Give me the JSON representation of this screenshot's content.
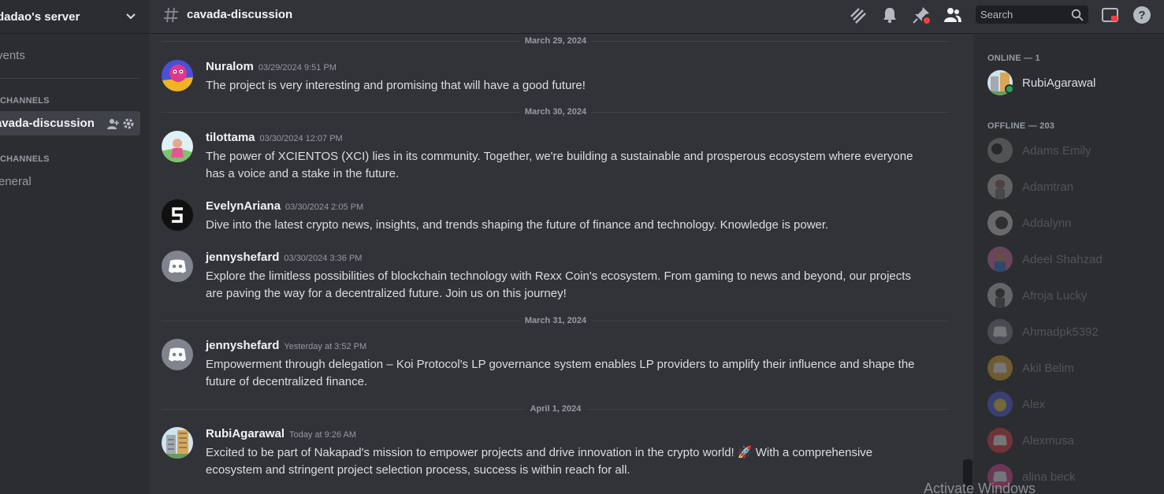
{
  "sidebar": {
    "server_name": "dadao's server",
    "events_label": "vents",
    "text_category": "CHANNELS",
    "active_channel": "avada-discussion",
    "voice_category": "CHANNELS",
    "general_label": "eneral"
  },
  "header": {
    "channel_name": "cavada-discussion",
    "search_placeholder": "Search"
  },
  "messages": [
    {
      "date": "March 29, 2024",
      "author": "Nuralom",
      "timestamp": "03/29/2024 9:51 PM",
      "text": "The project is very interesting and promising that will have a good future!"
    },
    {
      "date": "March 30, 2024",
      "author": "tilottama",
      "timestamp": "03/30/2024 12:07 PM",
      "text": "The power of XCIENTOS (XCI) lies in its community. Together, we're building a sustainable and prosperous ecosystem where everyone has a voice and a stake in the future."
    },
    {
      "author": "EvelynAriana",
      "timestamp": "03/30/2024 2:05 PM",
      "text": "Dive into the latest crypto news, insights, and trends shaping the future of finance and technology. Knowledge is power."
    },
    {
      "author": "jennyshefard",
      "timestamp": "03/30/2024 3:36 PM",
      "text": "Explore the limitless possibilities of blockchain technology with Rexx Coin's ecosystem. From gaming to news and beyond, our projects are paving the way for a decentralized future. Join us on this journey!"
    },
    {
      "date": "March 31, 2024",
      "author": "jennyshefard",
      "timestamp": "Yesterday at 3:52 PM",
      "text": "Empowerment through delegation – Koi Protocol's LP governance system enables LP providers to amplify their influence and shape the future of decentralized finance."
    },
    {
      "date": "April 1, 2024",
      "author": "RubiAgarawal",
      "timestamp": "Today at 9:26 AM",
      "text": "Excited to be part of Nakapad's mission to empower projects and drive innovation in the crypto world! 🚀 With a comprehensive ecosystem and stringent project selection process, success is within reach for all."
    }
  ],
  "members": {
    "online_header": "ONLINE — 1",
    "offline_header": "OFFLINE — 203",
    "online": [
      {
        "name": "RubiAgarawal"
      }
    ],
    "offline": [
      {
        "name": "Adams Emily"
      },
      {
        "name": "Adamtran"
      },
      {
        "name": "Addalynn"
      },
      {
        "name": "Adeel Shahzad"
      },
      {
        "name": "Afroja Lucky"
      },
      {
        "name": "Ahmadpk5392"
      },
      {
        "name": "Akil Belim"
      },
      {
        "name": "Alex"
      },
      {
        "name": "Alexmusa"
      },
      {
        "name": "alina beck"
      }
    ]
  },
  "watermark": "Activate Windows",
  "colors": {
    "background": "#313338",
    "sidebar": "#2b2d31",
    "online": "#23a55a",
    "notification_red": "#f23f43"
  }
}
